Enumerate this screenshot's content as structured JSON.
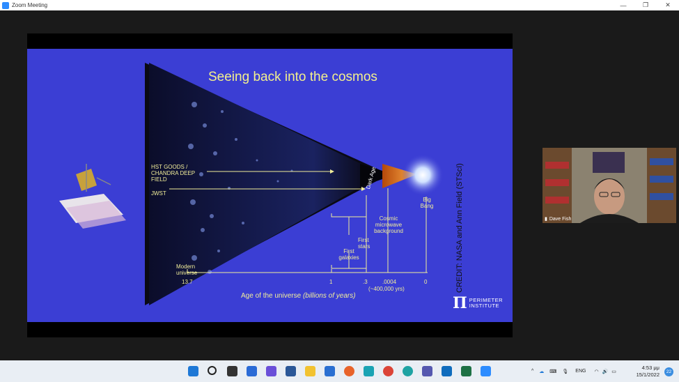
{
  "window": {
    "title": "Zoom Meeting",
    "minimize": "—",
    "restore": "❐",
    "close": "✕"
  },
  "slide": {
    "title": "Seeing back into the cosmos",
    "labels": {
      "hst": "HST GOODS / CHANDRA DEEP FIELD",
      "jwst": "JWST",
      "dark_age": "Dark Age",
      "big_bang": "Big Bang",
      "cmb": "Cosmic microwave background",
      "first_stars": "First stars",
      "first_galaxies": "First galaxies",
      "modern_universe": "Modern universe",
      "axis_title": "Age of the universe",
      "axis_unit": "(billions of years)",
      "tick_13_7": "13.7",
      "tick_1": "1",
      "tick_3": ".3",
      "tick_0004": ".0004",
      "tick_0004_sub": "(~400,000 yrs)",
      "tick_0": "0"
    },
    "credit": "CREDIT: NASA and Ann Field (STScI)",
    "logo_line1": "PERIMETER",
    "logo_line2": "INSTITUTE"
  },
  "participant": {
    "name": "Dave Fish"
  },
  "taskbar": {
    "language": "ENG",
    "time": "4:53 μμ",
    "date": "15/1/2022",
    "notifications": "22",
    "apps": [
      "windows-start",
      "search",
      "task-view",
      "widgets",
      "chat",
      "word",
      "file-explorer",
      "mail",
      "firefox",
      "snipping",
      "chrome",
      "edge",
      "teams",
      "outlook",
      "excel",
      "zoom"
    ]
  }
}
